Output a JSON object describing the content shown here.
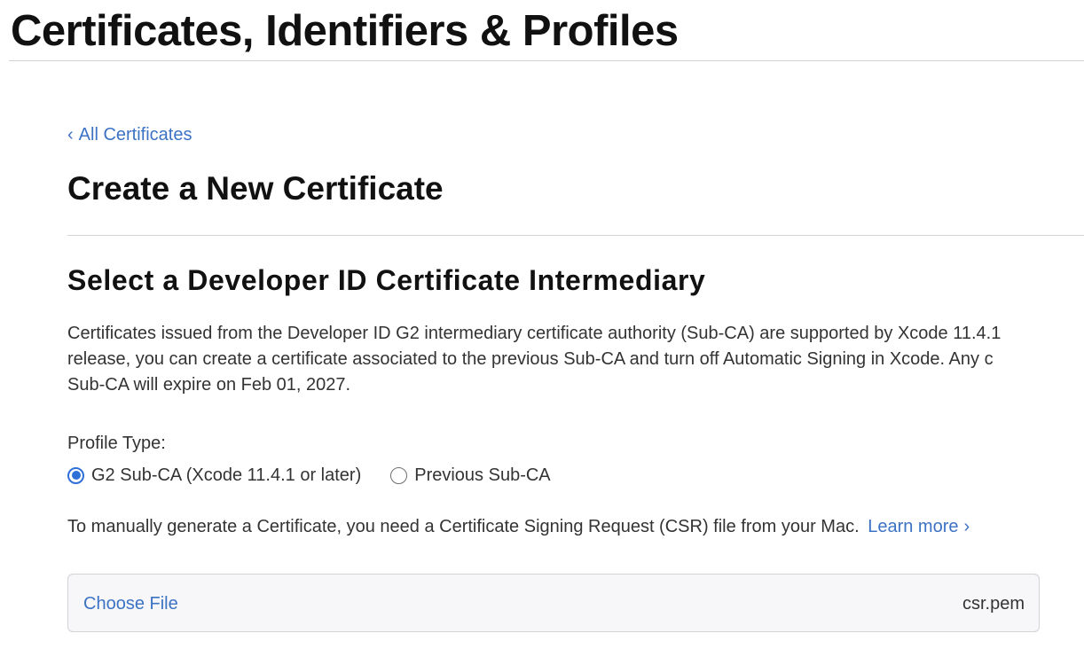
{
  "header": {
    "title": "Certificates, Identifiers & Profiles"
  },
  "nav": {
    "back_chevron": "‹",
    "back_label": "All Certificates"
  },
  "page": {
    "title": "Create a New Certificate"
  },
  "section": {
    "title": "Select a Developer ID Certificate Intermediary",
    "description_lines": [
      "Certificates issued from the Developer ID G2 intermediary certificate authority (Sub-CA) are supported by Xcode 11.4.1",
      "release, you can create a certificate associated to the previous Sub-CA and turn off Automatic Signing in Xcode. Any c",
      "Sub-CA will expire on Feb 01, 2027."
    ]
  },
  "profile_type": {
    "label": "Profile Type:",
    "options": [
      {
        "label": "G2 Sub-CA (Xcode 11.4.1 or later)",
        "selected": true
      },
      {
        "label": "Previous Sub-CA",
        "selected": false
      }
    ]
  },
  "csr": {
    "text": "To manually generate a Certificate, you need a Certificate Signing Request (CSR) file from your Mac.",
    "learn_more_label": "Learn more",
    "learn_more_chevron": "›"
  },
  "file_upload": {
    "choose_label": "Choose File",
    "file_name": "csr.pem"
  },
  "colors": {
    "link": "#3c72c4",
    "radio_selected": "#2f6fd8",
    "heading": "#111111",
    "body_text": "#333333",
    "divider": "#d2d2d7"
  },
  "icons": {
    "back": "chevron-left-icon",
    "learn_more": "chevron-right-icon",
    "radio_selected": "radio-checked-icon",
    "radio_unselected": "radio-unchecked-icon"
  }
}
